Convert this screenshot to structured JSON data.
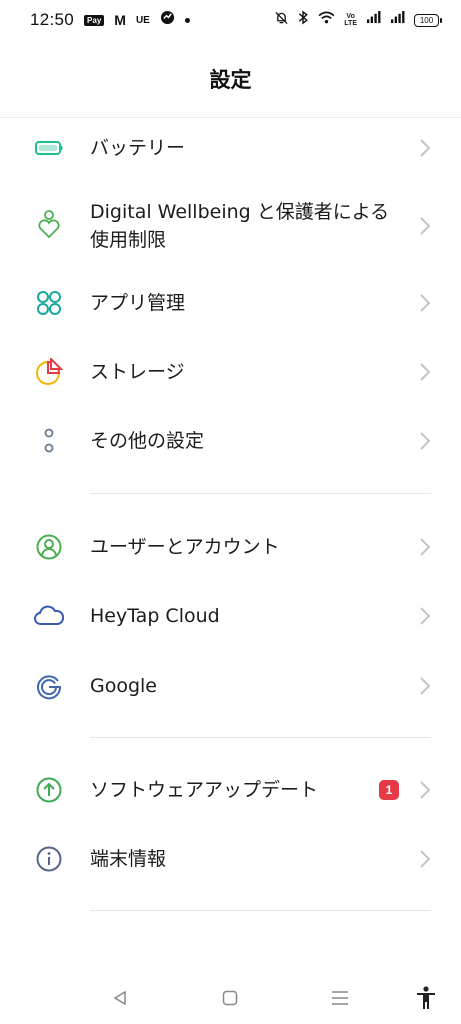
{
  "status_bar": {
    "time": "12:50",
    "notif_icons": [
      "Pay",
      "M",
      "UE"
    ],
    "battery_level": "100",
    "network": "VoLTE"
  },
  "header": {
    "title": "設定"
  },
  "groups": [
    {
      "items": [
        {
          "label": "バッテリー",
          "icon": "battery-icon",
          "color": "#1dbf8f"
        },
        {
          "label": "Digital Wellbeing と保護者による使用制限",
          "line1": "Digital Wellbeing と保護者による",
          "line2": "使用制限",
          "icon": "wellbeing-heart-icon",
          "color": "#4caf50"
        },
        {
          "label": "アプリ管理",
          "icon": "app-grid-icon",
          "color": "#16a99a"
        },
        {
          "label": "ストレージ",
          "icon": "storage-pie-icon",
          "color": "#f4b400"
        },
        {
          "label": "その他の設定",
          "icon": "more-dots-icon",
          "color": "#6a7a90"
        }
      ]
    },
    {
      "items": [
        {
          "label": "ユーザーとアカウント",
          "icon": "user-account-icon",
          "color": "#4caf50"
        },
        {
          "label": "HeyTap Cloud",
          "icon": "cloud-icon",
          "color": "#3b5bb5"
        },
        {
          "label": "Google",
          "icon": "google-g-icon",
          "color": "#4267b2"
        }
      ]
    },
    {
      "items": [
        {
          "label": "ソフトウェアアップデート",
          "icon": "update-arrow-icon",
          "color": "#3faa55",
          "badge": "1"
        },
        {
          "label": "端末情報",
          "icon": "info-icon",
          "color": "#556688"
        }
      ]
    }
  ],
  "nav": [
    "back-icon",
    "home-icon",
    "recents-icon",
    "accessibility-icon"
  ],
  "colors": {
    "badge": "#e53945",
    "chevron": "#c4c4c4"
  }
}
